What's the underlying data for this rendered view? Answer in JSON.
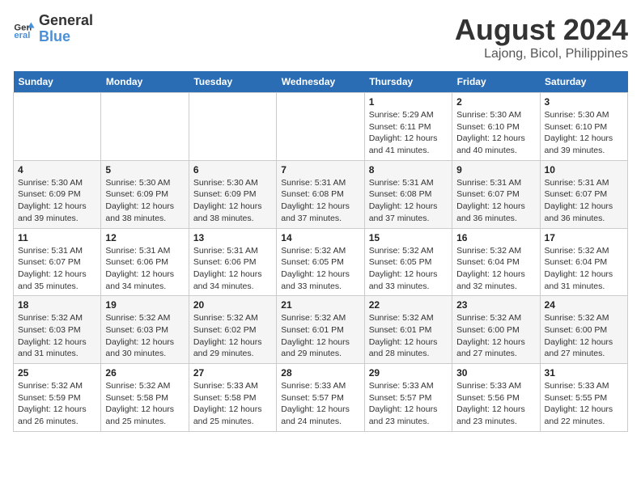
{
  "header": {
    "logo_line1": "General",
    "logo_line2": "Blue",
    "title": "August 2024",
    "subtitle": "Lajong, Bicol, Philippines"
  },
  "days_of_week": [
    "Sunday",
    "Monday",
    "Tuesday",
    "Wednesday",
    "Thursday",
    "Friday",
    "Saturday"
  ],
  "weeks": [
    [
      {
        "day": "",
        "info": ""
      },
      {
        "day": "",
        "info": ""
      },
      {
        "day": "",
        "info": ""
      },
      {
        "day": "",
        "info": ""
      },
      {
        "day": "1",
        "info": "Sunrise: 5:29 AM\nSunset: 6:11 PM\nDaylight: 12 hours\nand 41 minutes."
      },
      {
        "day": "2",
        "info": "Sunrise: 5:30 AM\nSunset: 6:10 PM\nDaylight: 12 hours\nand 40 minutes."
      },
      {
        "day": "3",
        "info": "Sunrise: 5:30 AM\nSunset: 6:10 PM\nDaylight: 12 hours\nand 39 minutes."
      }
    ],
    [
      {
        "day": "4",
        "info": "Sunrise: 5:30 AM\nSunset: 6:09 PM\nDaylight: 12 hours\nand 39 minutes."
      },
      {
        "day": "5",
        "info": "Sunrise: 5:30 AM\nSunset: 6:09 PM\nDaylight: 12 hours\nand 38 minutes."
      },
      {
        "day": "6",
        "info": "Sunrise: 5:30 AM\nSunset: 6:09 PM\nDaylight: 12 hours\nand 38 minutes."
      },
      {
        "day": "7",
        "info": "Sunrise: 5:31 AM\nSunset: 6:08 PM\nDaylight: 12 hours\nand 37 minutes."
      },
      {
        "day": "8",
        "info": "Sunrise: 5:31 AM\nSunset: 6:08 PM\nDaylight: 12 hours\nand 37 minutes."
      },
      {
        "day": "9",
        "info": "Sunrise: 5:31 AM\nSunset: 6:07 PM\nDaylight: 12 hours\nand 36 minutes."
      },
      {
        "day": "10",
        "info": "Sunrise: 5:31 AM\nSunset: 6:07 PM\nDaylight: 12 hours\nand 36 minutes."
      }
    ],
    [
      {
        "day": "11",
        "info": "Sunrise: 5:31 AM\nSunset: 6:07 PM\nDaylight: 12 hours\nand 35 minutes."
      },
      {
        "day": "12",
        "info": "Sunrise: 5:31 AM\nSunset: 6:06 PM\nDaylight: 12 hours\nand 34 minutes."
      },
      {
        "day": "13",
        "info": "Sunrise: 5:31 AM\nSunset: 6:06 PM\nDaylight: 12 hours\nand 34 minutes."
      },
      {
        "day": "14",
        "info": "Sunrise: 5:32 AM\nSunset: 6:05 PM\nDaylight: 12 hours\nand 33 minutes."
      },
      {
        "day": "15",
        "info": "Sunrise: 5:32 AM\nSunset: 6:05 PM\nDaylight: 12 hours\nand 33 minutes."
      },
      {
        "day": "16",
        "info": "Sunrise: 5:32 AM\nSunset: 6:04 PM\nDaylight: 12 hours\nand 32 minutes."
      },
      {
        "day": "17",
        "info": "Sunrise: 5:32 AM\nSunset: 6:04 PM\nDaylight: 12 hours\nand 31 minutes."
      }
    ],
    [
      {
        "day": "18",
        "info": "Sunrise: 5:32 AM\nSunset: 6:03 PM\nDaylight: 12 hours\nand 31 minutes."
      },
      {
        "day": "19",
        "info": "Sunrise: 5:32 AM\nSunset: 6:03 PM\nDaylight: 12 hours\nand 30 minutes."
      },
      {
        "day": "20",
        "info": "Sunrise: 5:32 AM\nSunset: 6:02 PM\nDaylight: 12 hours\nand 29 minutes."
      },
      {
        "day": "21",
        "info": "Sunrise: 5:32 AM\nSunset: 6:01 PM\nDaylight: 12 hours\nand 29 minutes."
      },
      {
        "day": "22",
        "info": "Sunrise: 5:32 AM\nSunset: 6:01 PM\nDaylight: 12 hours\nand 28 minutes."
      },
      {
        "day": "23",
        "info": "Sunrise: 5:32 AM\nSunset: 6:00 PM\nDaylight: 12 hours\nand 27 minutes."
      },
      {
        "day": "24",
        "info": "Sunrise: 5:32 AM\nSunset: 6:00 PM\nDaylight: 12 hours\nand 27 minutes."
      }
    ],
    [
      {
        "day": "25",
        "info": "Sunrise: 5:32 AM\nSunset: 5:59 PM\nDaylight: 12 hours\nand 26 minutes."
      },
      {
        "day": "26",
        "info": "Sunrise: 5:32 AM\nSunset: 5:58 PM\nDaylight: 12 hours\nand 25 minutes."
      },
      {
        "day": "27",
        "info": "Sunrise: 5:33 AM\nSunset: 5:58 PM\nDaylight: 12 hours\nand 25 minutes."
      },
      {
        "day": "28",
        "info": "Sunrise: 5:33 AM\nSunset: 5:57 PM\nDaylight: 12 hours\nand 24 minutes."
      },
      {
        "day": "29",
        "info": "Sunrise: 5:33 AM\nSunset: 5:57 PM\nDaylight: 12 hours\nand 23 minutes."
      },
      {
        "day": "30",
        "info": "Sunrise: 5:33 AM\nSunset: 5:56 PM\nDaylight: 12 hours\nand 23 minutes."
      },
      {
        "day": "31",
        "info": "Sunrise: 5:33 AM\nSunset: 5:55 PM\nDaylight: 12 hours\nand 22 minutes."
      }
    ]
  ]
}
